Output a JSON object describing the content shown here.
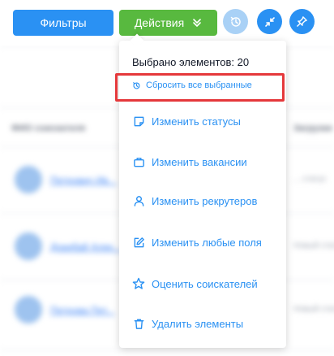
{
  "toolbar": {
    "filters_label": "Фильтры",
    "actions_label": "Действия"
  },
  "menu": {
    "selected_count_label": "Выбрано элементов: 20",
    "reset_label": "Сбросить все выбранные",
    "items": [
      {
        "label": "Изменить статусы",
        "icon": "note-icon"
      },
      {
        "label": "Изменить вакансии",
        "icon": "briefcase-icon"
      },
      {
        "label": "Изменить рекрутеров",
        "icon": "user-icon"
      },
      {
        "label": "Изменить любые поля",
        "icon": "edit-icon"
      },
      {
        "label": "Оценить соискателей",
        "icon": "star-icon"
      },
      {
        "label": "Удалить элементы",
        "icon": "trash-icon"
      }
    ]
  },
  "colors": {
    "primary_blue": "#2a91f3",
    "actions_green": "#58b93f",
    "highlight_red": "#e5383b"
  }
}
